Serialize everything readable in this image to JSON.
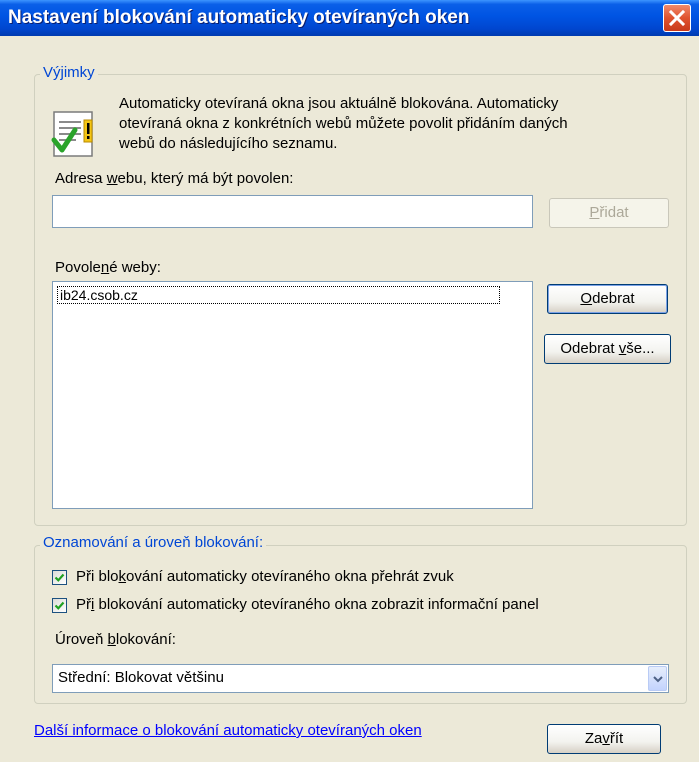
{
  "window": {
    "title": "Nastavení blokování automaticky otevíraných oken"
  },
  "exceptions": {
    "legend": "Výjimky",
    "description_lines": [
      "Automaticky otevíraná okna jsou aktuálně blokována. Automaticky",
      "otevíraná okna z konkrétních webů můžete povolit přidáním daných",
      "webů do následujícího seznamu."
    ],
    "address_label_pre": "Adresa ",
    "address_label_key": "w",
    "address_label_post": "ebu, který má být povolen:",
    "address_value": "",
    "add_button_key": "P",
    "add_button_rest": "řidat",
    "allowed_label_pre": "Povole",
    "allowed_label_key": "n",
    "allowed_label_post": "é weby:",
    "allowed_sites": [
      "ib24.csob.cz"
    ],
    "remove_button_key": "O",
    "remove_button_rest": "debrat",
    "remove_all_pre": "Odebrat ",
    "remove_all_key": "v",
    "remove_all_post": "še..."
  },
  "notifications": {
    "legend": "Oznamování a úroveň blokování:",
    "check1_pre": "Při blo",
    "check1_key": "k",
    "check1_post": "ování automaticky otevíraného okna přehrát zvuk",
    "check1_checked": true,
    "check2_pre": "Př",
    "check2_key": "i",
    "check2_post": " blokování automaticky otevíraného okna zobrazit informační panel",
    "check2_checked": true,
    "level_label_pre": "Úroveň ",
    "level_label_key": "b",
    "level_label_post": "lokování:",
    "level_value": "Střední: Blokovat většinu"
  },
  "footer": {
    "more_info_link": "Další informace o blokování automaticky otevíraných oken",
    "close_pre": "Za",
    "close_key": "v",
    "close_post": "řít"
  }
}
